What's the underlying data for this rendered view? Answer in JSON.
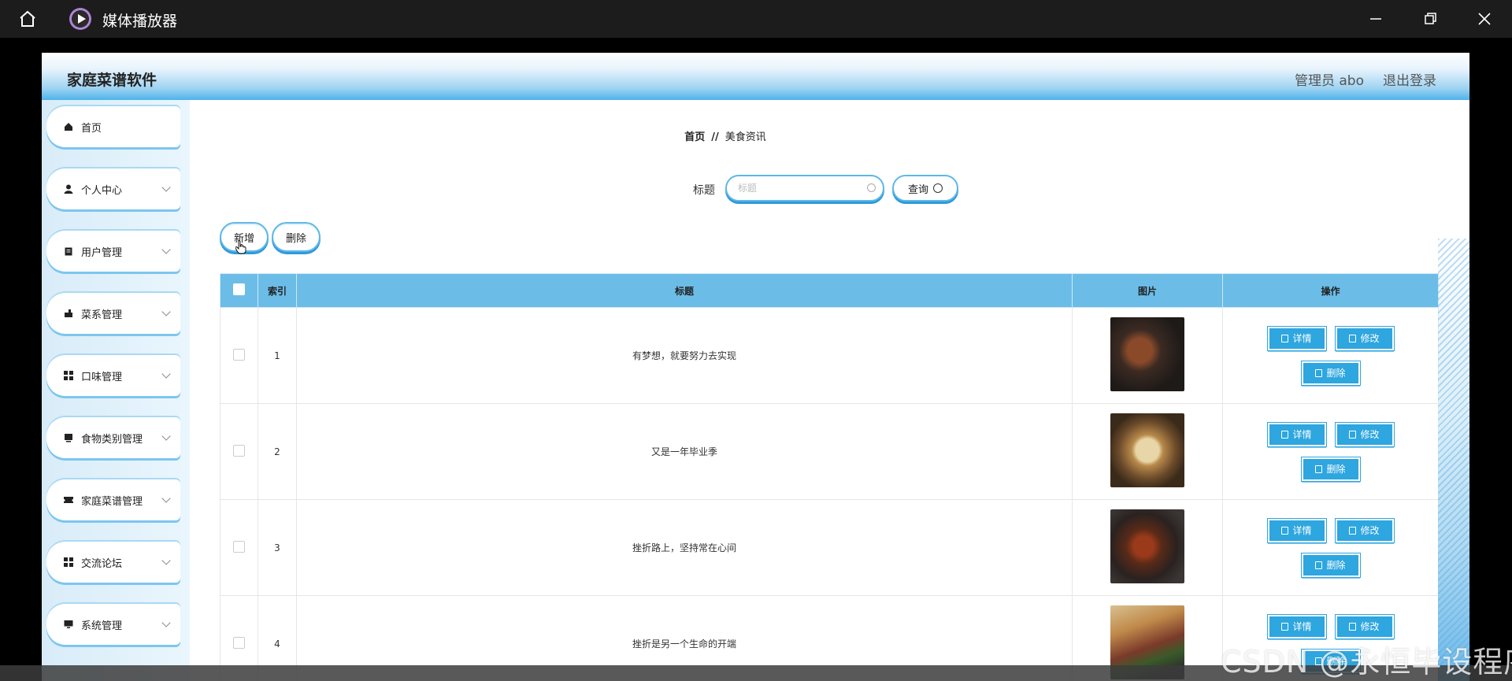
{
  "player": {
    "title": "媒体播放器",
    "home_icon": "home-icon",
    "min_icon": "minimize-icon",
    "max_icon": "restore-icon",
    "close_icon": "close-icon"
  },
  "app": {
    "title": "家庭菜谱软件",
    "admin_label": "管理员 abo",
    "logout_label": "退出登录"
  },
  "sidebar": {
    "items": [
      {
        "label": "首页",
        "icon": "home-icon",
        "expandable": false
      },
      {
        "label": "个人中心",
        "icon": "user-icon",
        "expandable": true
      },
      {
        "label": "用户管理",
        "icon": "clipboard-icon",
        "expandable": true
      },
      {
        "label": "菜系管理",
        "icon": "cup-icon",
        "expandable": true
      },
      {
        "label": "口味管理",
        "icon": "grid-icon",
        "expandable": true
      },
      {
        "label": "食物类别管理",
        "icon": "card-icon",
        "expandable": true
      },
      {
        "label": "家庭菜谱管理",
        "icon": "ticket-icon",
        "expandable": true
      },
      {
        "label": "交流论坛",
        "icon": "grid-icon",
        "expandable": true
      },
      {
        "label": "系统管理",
        "icon": "monitor-icon",
        "expandable": true
      }
    ]
  },
  "breadcrumb": {
    "home": "首页",
    "separator": "//",
    "current": "美食资讯"
  },
  "search": {
    "label": "标题",
    "placeholder": "标题",
    "value": "",
    "button_label": "查询"
  },
  "actions": {
    "add_label": "新增",
    "delete_label": "删除"
  },
  "table": {
    "headers": {
      "index": "索引",
      "title": "标题",
      "image": "图片",
      "ops": "操作"
    },
    "rows": [
      {
        "index": "1",
        "title": "有梦想，就要努力去实现"
      },
      {
        "index": "2",
        "title": "又是一年毕业季"
      },
      {
        "index": "3",
        "title": "挫折路上，坚持常在心间"
      },
      {
        "index": "4",
        "title": "挫折是另一个生命的开端"
      }
    ],
    "ops": {
      "detail": "详情",
      "edit": "修改",
      "delete": "删除"
    }
  },
  "watermark": "CSDN @永恒毕设程序",
  "colors": {
    "accent": "#2ea6df",
    "header_bar": "#6bbde8",
    "player_bg": "#1c1c1c"
  }
}
